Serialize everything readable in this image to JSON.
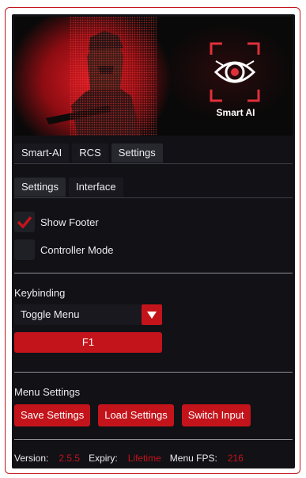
{
  "banner": {
    "logo_text": "Smart AI"
  },
  "main_tabs": [
    {
      "label": "Smart-AI",
      "active": false
    },
    {
      "label": "RCS",
      "active": false
    },
    {
      "label": "Settings",
      "active": true
    }
  ],
  "sub_tabs": [
    {
      "label": "Settings",
      "active": true
    },
    {
      "label": "Interface",
      "active": false
    }
  ],
  "options": {
    "show_footer": {
      "label": "Show Footer",
      "checked": true
    },
    "controller_mode": {
      "label": "Controller Mode",
      "checked": false
    }
  },
  "keybinding": {
    "title": "Keybinding",
    "action": "Toggle Menu",
    "key": "F1"
  },
  "menu_settings": {
    "title": "Menu Settings",
    "buttons": [
      "Save Settings",
      "Load Settings",
      "Switch Input"
    ]
  },
  "footer": {
    "version_label": "Version:",
    "version": "2.5.5",
    "expiry_label": "Expiry:",
    "expiry": "Lifetime",
    "fps_label": "Menu FPS:",
    "fps": "216"
  },
  "colors": {
    "accent": "#c4141b",
    "panel_bg": "#111116",
    "tab_bg": "#18181e",
    "tab_active_bg": "#27272e"
  }
}
